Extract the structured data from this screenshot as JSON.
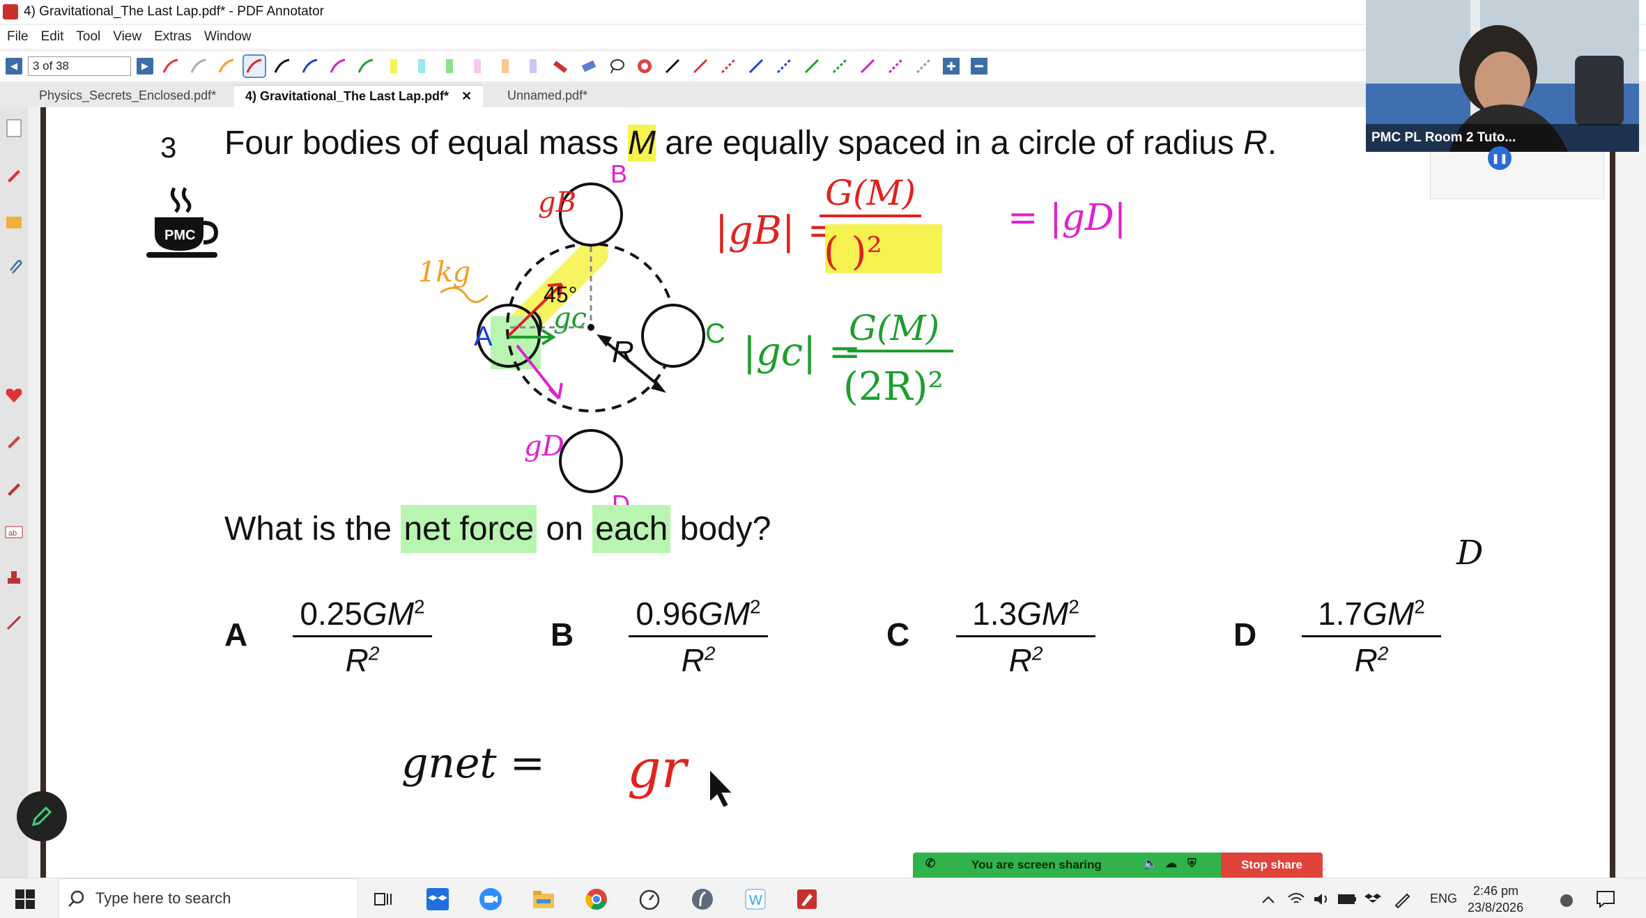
{
  "window": {
    "title": "4) Gravitational_The Last Lap.pdf* - PDF Annotator"
  },
  "menu": [
    "File",
    "Edit",
    "Tool",
    "View",
    "Extras",
    "Window"
  ],
  "toolbar": {
    "page_indicator": "3 of 38"
  },
  "tabs": [
    {
      "label": "Physics_Secrets_Enclosed.pdf*",
      "active": false
    },
    {
      "label": "4) Gravitational_The Last Lap.pdf*",
      "active": true
    },
    {
      "label": "Unnamed.pdf*",
      "active": false
    }
  ],
  "document": {
    "question_number": "3",
    "q_before": "Four bodies of equal mass ",
    "q_mass": "M",
    "q_middle": " are equally spaced in a circle of radius ",
    "q_radius": "R",
    "q_end": ".",
    "logo_text": "PMC",
    "q2_before": "What is the ",
    "q2_hl1": "net force",
    "q2_mid": " on ",
    "q2_hl2": "each",
    "q2_end": " body?",
    "options": [
      {
        "letter": "A",
        "coef": "0.25",
        "num_rest": "GM",
        "num_exp": "2",
        "den": "R",
        "den_exp": "2"
      },
      {
        "letter": "B",
        "coef": "0.96",
        "num_rest": "GM",
        "num_exp": "2",
        "den": "R",
        "den_exp": "2"
      },
      {
        "letter": "C",
        "coef": "1.3",
        "num_rest": "GM",
        "num_exp": "2",
        "den": "R",
        "den_exp": "2"
      },
      {
        "letter": "D",
        "coef": "1.7",
        "num_rest": "GM",
        "num_exp": "2",
        "den": "R",
        "den_exp": "2"
      }
    ],
    "diagram": {
      "label_A": "A",
      "label_B": "B",
      "label_C": "C",
      "label_D": "D",
      "label_R": "R",
      "angle": "45°"
    },
    "handwriting": {
      "g_B": "gB",
      "g_C": "gc",
      "g_D": "gD",
      "one_kg": "1kg",
      "eq_gb": "|gB| =",
      "eq_gb_num": "G(M)",
      "eq_gb_den": "(      )²",
      "eq_gd": "= |gD|",
      "eq_gc": "|gc| =",
      "eq_gc_num": "G(M)",
      "eq_gc_den": "(2R)²",
      "answer_mark": "D",
      "gnet": "gnet  =",
      "gr": "gr"
    }
  },
  "webcam": {
    "label": "PMC PL Room 2 Tuto..."
  },
  "share": {
    "status": "You are screen sharing",
    "stop_label": "Stop share"
  },
  "taskbar": {
    "search_placeholder": "Type here to search",
    "lang": "ENG",
    "time": "2:46 pm",
    "date": "23/8/2026"
  },
  "colors": {
    "ink_red": "#e0221f",
    "ink_green": "#1e9e2e",
    "ink_magenta": "#e020d0",
    "ink_orange": "#f0a020",
    "highlight_yellow": "#f6f350",
    "highlight_green": "#b8f5b0"
  }
}
